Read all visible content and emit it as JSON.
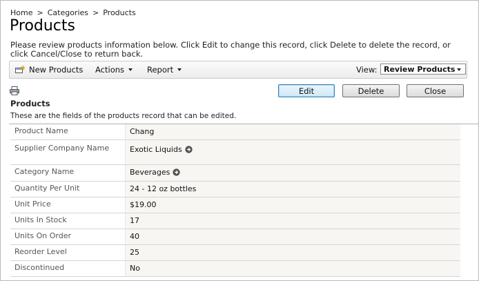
{
  "breadcrumb": {
    "items": [
      "Home",
      "Categories",
      "Products"
    ],
    "separator": ">"
  },
  "page": {
    "title": "Products",
    "intro": "Please review products information below. Click Edit to change this record, click Delete to delete the record, or click Cancel/Close to return back."
  },
  "toolbar": {
    "new_label": "New Products",
    "actions_label": "Actions",
    "report_label": "Report",
    "view_label": "View:",
    "view_value": "Review Products"
  },
  "buttons": {
    "edit": "Edit",
    "delete": "Delete",
    "close": "Close"
  },
  "section": {
    "title": "Products",
    "description": "These are the fields of the products record that can be edited."
  },
  "fields": [
    {
      "label": "Product Name",
      "value": "Chang"
    },
    {
      "label": "Supplier Company Name",
      "value": "Exotic Liquids",
      "link": true
    },
    {
      "label": "Category Name",
      "value": "Beverages",
      "link": true
    },
    {
      "label": "Quantity Per Unit",
      "value": "24 - 12 oz bottles"
    },
    {
      "label": "Unit Price",
      "value": "$19.00"
    },
    {
      "label": "Units In Stock",
      "value": "17"
    },
    {
      "label": "Units On Order",
      "value": "40"
    },
    {
      "label": "Reorder Level",
      "value": "25"
    },
    {
      "label": "Discontinued",
      "value": "No"
    }
  ],
  "colors": {
    "edit_button_border": "#3c7fb1",
    "value_background": "#f8f6f3",
    "link_arrow": "#555555"
  }
}
